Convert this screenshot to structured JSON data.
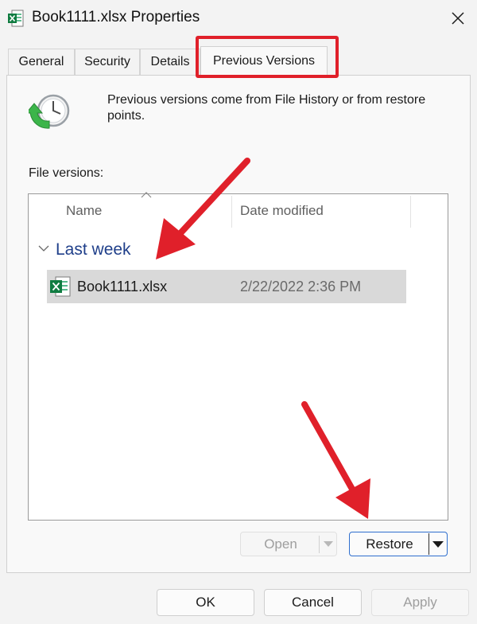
{
  "window": {
    "title": "Book1111.xlsx Properties",
    "icon": "excel-file-icon",
    "close_icon": "close-icon"
  },
  "tabs": [
    {
      "label": "General",
      "active": false
    },
    {
      "label": "Security",
      "active": false
    },
    {
      "label": "Details",
      "active": false
    },
    {
      "label": "Previous Versions",
      "active": true
    }
  ],
  "previous_versions": {
    "icon": "restore-clock-icon",
    "description": "Previous versions come from File History or from restore points.",
    "file_versions_label": "File versions:",
    "columns": {
      "name": "Name",
      "date_modified": "Date modified"
    },
    "groups": [
      {
        "label": "Last week",
        "items": [
          {
            "name": "Book1111.xlsx",
            "date_modified": "2/22/2022 2:36 PM",
            "selected": true
          }
        ]
      }
    ],
    "buttons": {
      "open": "Open",
      "restore": "Restore"
    }
  },
  "footer": {
    "ok": "OK",
    "cancel": "Cancel",
    "apply": "Apply"
  },
  "colors": {
    "annotation": "#e0202a",
    "group_label": "#1f3f8a",
    "focus_border": "#2f6fce"
  }
}
